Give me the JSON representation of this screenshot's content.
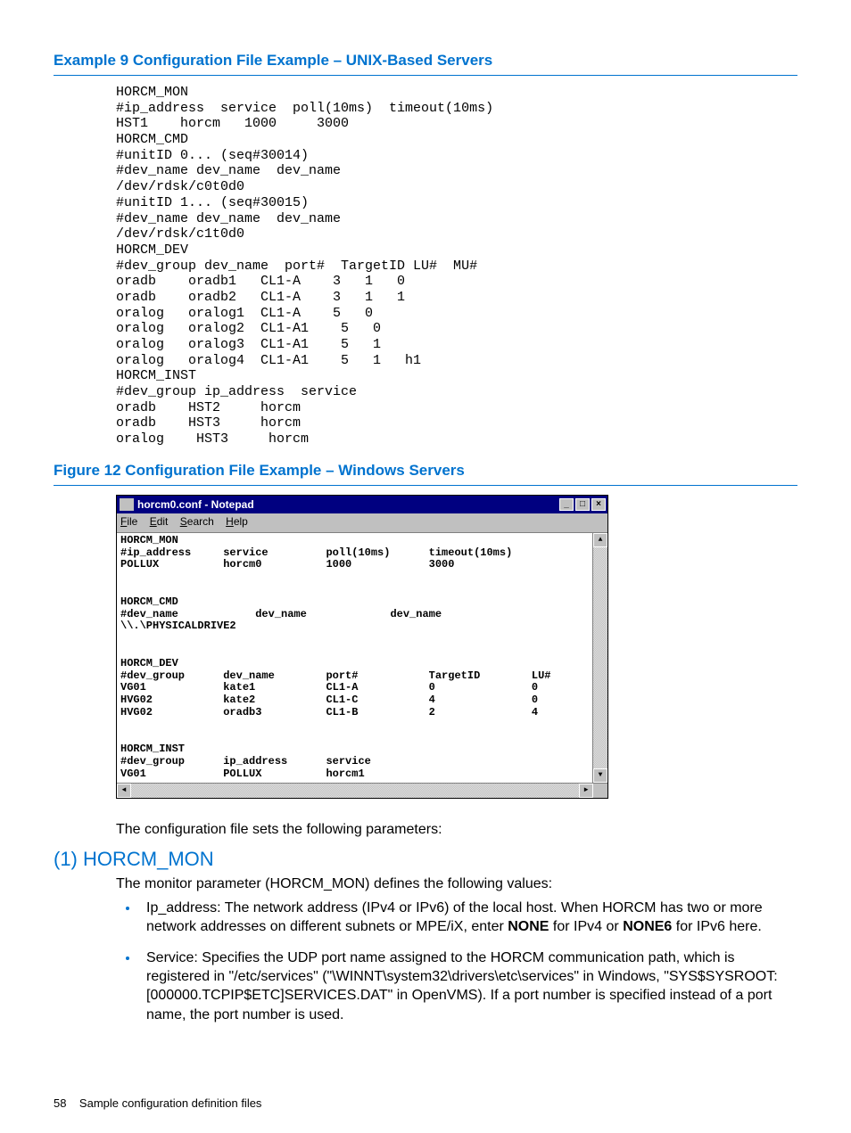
{
  "example9": {
    "title": "Example 9 Configuration File Example – UNIX-Based Servers",
    "code": "HORCM_MON\n#ip_address  service  poll(10ms)  timeout(10ms)\nHST1    horcm   1000     3000\nHORCM_CMD\n#unitID 0... (seq#30014)\n#dev_name dev_name  dev_name\n/dev/rdsk/c0t0d0\n#unitID 1... (seq#30015)\n#dev_name dev_name  dev_name\n/dev/rdsk/c1t0d0\nHORCM_DEV\n#dev_group dev_name  port#  TargetID LU#  MU#\noradb    oradb1   CL1-A    3   1   0\noradb    oradb2   CL1-A    3   1   1\noralog   oralog1  CL1-A    5   0\noralog   oralog2  CL1-A1    5   0\noralog   oralog3  CL1-A1    5   1\noralog   oralog4  CL1-A1    5   1   h1\nHORCM_INST\n#dev_group ip_address  service\noradb    HST2     horcm\noradb    HST3     horcm\noralog    HST3     horcm"
  },
  "figure12": {
    "title": "Figure 12 Configuration File Example – Windows Servers",
    "window_title": "horcm0.conf - Notepad",
    "menu": {
      "file": "File",
      "edit": "Edit",
      "search": "Search",
      "help": "Help"
    },
    "content": "HORCM_MON\n#ip_address     service         poll(10ms)      timeout(10ms)\nPOLLUX          horcm0          1000            3000\n\n\nHORCM_CMD\n#dev_name            dev_name             dev_name\n\\\\.\\PHYSICALDRIVE2\n\n\nHORCM_DEV\n#dev_group      dev_name        port#           TargetID        LU#\nVG01            kate1           CL1-A           0               0\nHVG02           kate2           CL1-C           4               0\nHVG02           oradb3          CL1-B           2               4\n\n\nHORCM_INST\n#dev_group      ip_address      service\nVG01            POLLUX          horcm1\n"
  },
  "intro_text": "The configuration file sets the following parameters:",
  "section": {
    "heading": "(1) HORCM_MON",
    "lead": "The monitor parameter (HORCM_MON) defines the following values:",
    "bullets": [
      {
        "pre": "Ip_address: The network address (IPv4 or IPv6) of the local host. When HORCM has two or more network addresses on different subnets or MPE/iX, enter ",
        "b1": "NONE",
        "mid": " for IPv4 or ",
        "b2": "NONE6",
        "post": " for IPv6 here."
      },
      {
        "full": "Service: Specifies the UDP port name assigned to the HORCM communication path, which is registered in \"/etc/services\" (\"\\WINNT\\system32\\drivers\\etc\\services\" in Windows, \"SYS$SYSROOT:[000000.TCPIP$ETC]SERVICES.DAT\" in OpenVMS). If a port number is specified instead of a port name, the port number is used."
      }
    ]
  },
  "footer": {
    "page": "58",
    "text": "Sample configuration definition files"
  }
}
